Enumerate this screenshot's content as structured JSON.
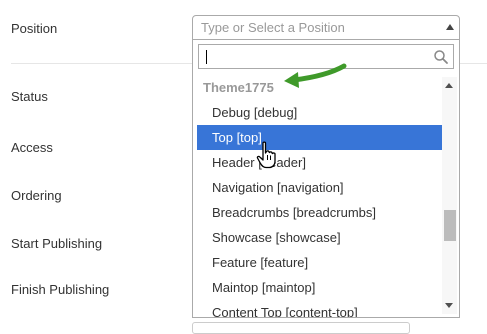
{
  "form": {
    "labels": {
      "position": "Position",
      "status": "Status",
      "access": "Access",
      "ordering": "Ordering",
      "start_publishing": "Start Publishing",
      "finish_publishing": "Finish Publishing"
    }
  },
  "position_select": {
    "placeholder": "Type or Select a Position",
    "search_value": "",
    "group_label": "Theme1775",
    "options": [
      {
        "label": "Debug [debug]"
      },
      {
        "label": "Top [top]"
      },
      {
        "label": "Header [header]"
      },
      {
        "label": "Navigation [navigation]"
      },
      {
        "label": "Breadcrumbs [breadcrumbs]"
      },
      {
        "label": "Showcase [showcase]"
      },
      {
        "label": "Feature [feature]"
      },
      {
        "label": "Maintop [maintop]"
      },
      {
        "label": "Content Top [content-top]"
      }
    ],
    "highlighted_index": 1
  },
  "icons": {
    "search": "search-icon",
    "caret_up": "chevron-up-icon",
    "scroll_up": "scroll-up-arrow-icon",
    "scroll_down": "scroll-down-arrow-icon",
    "pointer": "hand-pointer-cursor",
    "annotation_arrow": "green-arrow-annotation"
  },
  "colors": {
    "highlight": "#3875d7",
    "annotation_arrow": "#3f9a2a"
  }
}
